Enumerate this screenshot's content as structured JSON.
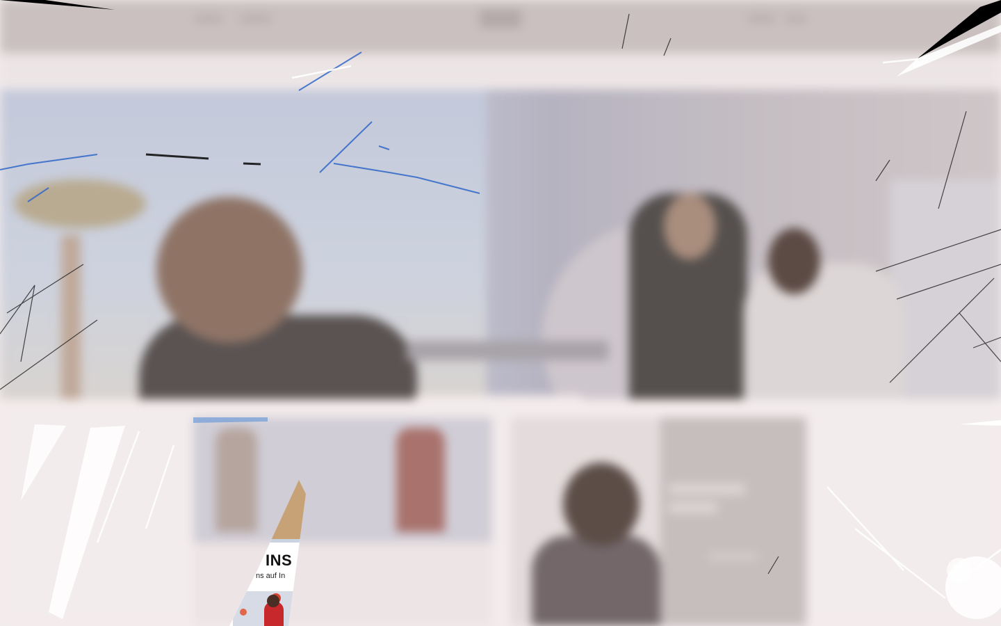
{
  "window": {
    "description_visible": false
  },
  "overlay": {
    "type": "cracked-glass",
    "crack_color_dark": "#000000",
    "crack_color_blue": "#2f66c8",
    "crack_color_light": "#ffffff"
  },
  "site": {
    "navigation": {
      "logo_icon": "logo-icon"
    },
    "hero": {
      "cta_icon": "button-placeholder"
    },
    "promo": {
      "instagram_heading": "INS",
      "instagram_subtext": "ns auf In"
    }
  },
  "colors": {
    "page_bg": "#f3ecec",
    "nav_bg": "#c9c0bf",
    "hero_accent": "#b3a86f"
  }
}
